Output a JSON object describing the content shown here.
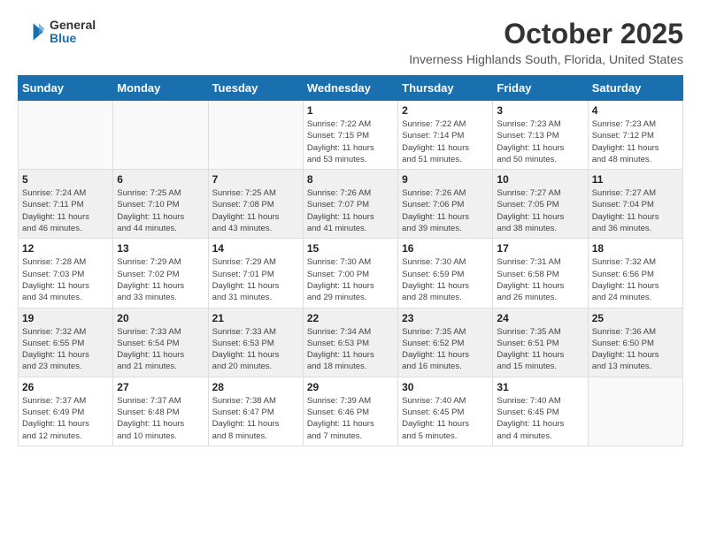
{
  "header": {
    "logo": {
      "general": "General",
      "blue": "Blue"
    },
    "title": "October 2025",
    "subtitle": "Inverness Highlands South, Florida, United States"
  },
  "weekdays": [
    "Sunday",
    "Monday",
    "Tuesday",
    "Wednesday",
    "Thursday",
    "Friday",
    "Saturday"
  ],
  "weeks": [
    {
      "shade": "white",
      "days": [
        {
          "num": "",
          "info": ""
        },
        {
          "num": "",
          "info": ""
        },
        {
          "num": "",
          "info": ""
        },
        {
          "num": "1",
          "info": "Sunrise: 7:22 AM\nSunset: 7:15 PM\nDaylight: 11 hours\nand 53 minutes."
        },
        {
          "num": "2",
          "info": "Sunrise: 7:22 AM\nSunset: 7:14 PM\nDaylight: 11 hours\nand 51 minutes."
        },
        {
          "num": "3",
          "info": "Sunrise: 7:23 AM\nSunset: 7:13 PM\nDaylight: 11 hours\nand 50 minutes."
        },
        {
          "num": "4",
          "info": "Sunrise: 7:23 AM\nSunset: 7:12 PM\nDaylight: 11 hours\nand 48 minutes."
        }
      ]
    },
    {
      "shade": "shaded",
      "days": [
        {
          "num": "5",
          "info": "Sunrise: 7:24 AM\nSunset: 7:11 PM\nDaylight: 11 hours\nand 46 minutes."
        },
        {
          "num": "6",
          "info": "Sunrise: 7:25 AM\nSunset: 7:10 PM\nDaylight: 11 hours\nand 44 minutes."
        },
        {
          "num": "7",
          "info": "Sunrise: 7:25 AM\nSunset: 7:08 PM\nDaylight: 11 hours\nand 43 minutes."
        },
        {
          "num": "8",
          "info": "Sunrise: 7:26 AM\nSunset: 7:07 PM\nDaylight: 11 hours\nand 41 minutes."
        },
        {
          "num": "9",
          "info": "Sunrise: 7:26 AM\nSunset: 7:06 PM\nDaylight: 11 hours\nand 39 minutes."
        },
        {
          "num": "10",
          "info": "Sunrise: 7:27 AM\nSunset: 7:05 PM\nDaylight: 11 hours\nand 38 minutes."
        },
        {
          "num": "11",
          "info": "Sunrise: 7:27 AM\nSunset: 7:04 PM\nDaylight: 11 hours\nand 36 minutes."
        }
      ]
    },
    {
      "shade": "white",
      "days": [
        {
          "num": "12",
          "info": "Sunrise: 7:28 AM\nSunset: 7:03 PM\nDaylight: 11 hours\nand 34 minutes."
        },
        {
          "num": "13",
          "info": "Sunrise: 7:29 AM\nSunset: 7:02 PM\nDaylight: 11 hours\nand 33 minutes."
        },
        {
          "num": "14",
          "info": "Sunrise: 7:29 AM\nSunset: 7:01 PM\nDaylight: 11 hours\nand 31 minutes."
        },
        {
          "num": "15",
          "info": "Sunrise: 7:30 AM\nSunset: 7:00 PM\nDaylight: 11 hours\nand 29 minutes."
        },
        {
          "num": "16",
          "info": "Sunrise: 7:30 AM\nSunset: 6:59 PM\nDaylight: 11 hours\nand 28 minutes."
        },
        {
          "num": "17",
          "info": "Sunrise: 7:31 AM\nSunset: 6:58 PM\nDaylight: 11 hours\nand 26 minutes."
        },
        {
          "num": "18",
          "info": "Sunrise: 7:32 AM\nSunset: 6:56 PM\nDaylight: 11 hours\nand 24 minutes."
        }
      ]
    },
    {
      "shade": "shaded",
      "days": [
        {
          "num": "19",
          "info": "Sunrise: 7:32 AM\nSunset: 6:55 PM\nDaylight: 11 hours\nand 23 minutes."
        },
        {
          "num": "20",
          "info": "Sunrise: 7:33 AM\nSunset: 6:54 PM\nDaylight: 11 hours\nand 21 minutes."
        },
        {
          "num": "21",
          "info": "Sunrise: 7:33 AM\nSunset: 6:53 PM\nDaylight: 11 hours\nand 20 minutes."
        },
        {
          "num": "22",
          "info": "Sunrise: 7:34 AM\nSunset: 6:53 PM\nDaylight: 11 hours\nand 18 minutes."
        },
        {
          "num": "23",
          "info": "Sunrise: 7:35 AM\nSunset: 6:52 PM\nDaylight: 11 hours\nand 16 minutes."
        },
        {
          "num": "24",
          "info": "Sunrise: 7:35 AM\nSunset: 6:51 PM\nDaylight: 11 hours\nand 15 minutes."
        },
        {
          "num": "25",
          "info": "Sunrise: 7:36 AM\nSunset: 6:50 PM\nDaylight: 11 hours\nand 13 minutes."
        }
      ]
    },
    {
      "shade": "white",
      "days": [
        {
          "num": "26",
          "info": "Sunrise: 7:37 AM\nSunset: 6:49 PM\nDaylight: 11 hours\nand 12 minutes."
        },
        {
          "num": "27",
          "info": "Sunrise: 7:37 AM\nSunset: 6:48 PM\nDaylight: 11 hours\nand 10 minutes."
        },
        {
          "num": "28",
          "info": "Sunrise: 7:38 AM\nSunset: 6:47 PM\nDaylight: 11 hours\nand 8 minutes."
        },
        {
          "num": "29",
          "info": "Sunrise: 7:39 AM\nSunset: 6:46 PM\nDaylight: 11 hours\nand 7 minutes."
        },
        {
          "num": "30",
          "info": "Sunrise: 7:40 AM\nSunset: 6:45 PM\nDaylight: 11 hours\nand 5 minutes."
        },
        {
          "num": "31",
          "info": "Sunrise: 7:40 AM\nSunset: 6:45 PM\nDaylight: 11 hours\nand 4 minutes."
        },
        {
          "num": "",
          "info": ""
        }
      ]
    }
  ]
}
